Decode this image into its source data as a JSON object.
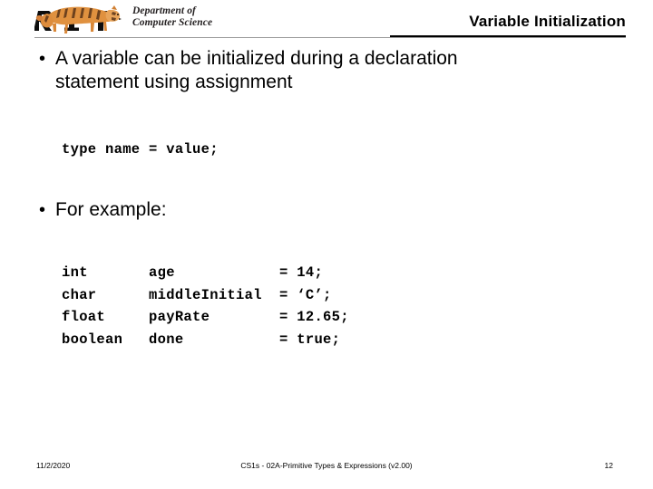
{
  "header": {
    "logo": {
      "icon": "rit-tiger-logo-icon",
      "wordmark": "RIT",
      "tiger_color": "#d4803a",
      "wordmark_color": "#000000"
    },
    "department_line1": "Department of",
    "department_line2": "Computer Science",
    "title": "Variable Initialization"
  },
  "body": {
    "bullets": [
      {
        "marker": "•",
        "text": "A variable can be initialized during a declaration statement using assignment"
      },
      {
        "marker": "•",
        "text": "For example:"
      }
    ],
    "code_syntax": "type name = value;",
    "code_examples": "int       age            = 14;\nchar      middleInitial  = ‘C’;\nfloat     payRate        = 12.65;\nboolean   done           = true;"
  },
  "footer": {
    "date": "11/2/2020",
    "center": "CS1s - 02A-Primitive Types & Expressions  (v2.00)",
    "page_number": "12"
  }
}
